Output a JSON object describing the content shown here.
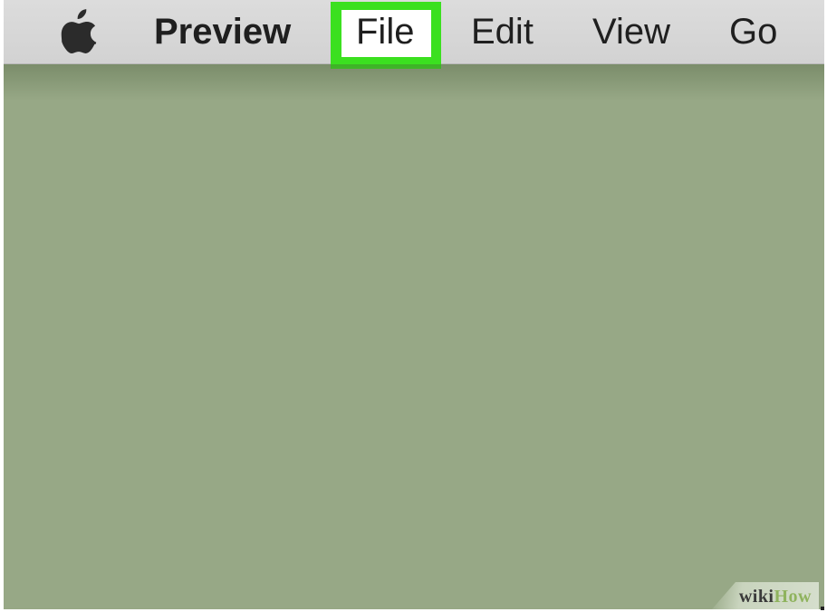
{
  "menubar": {
    "apple_icon": "apple-logo-icon",
    "app_name": "Preview",
    "items": [
      "File",
      "Edit",
      "View",
      "Go"
    ],
    "highlighted_item": "File",
    "highlight_color": "#3be01f"
  },
  "background_color": "#97a886",
  "watermark": {
    "part1": "wiki",
    "part2": "How"
  }
}
